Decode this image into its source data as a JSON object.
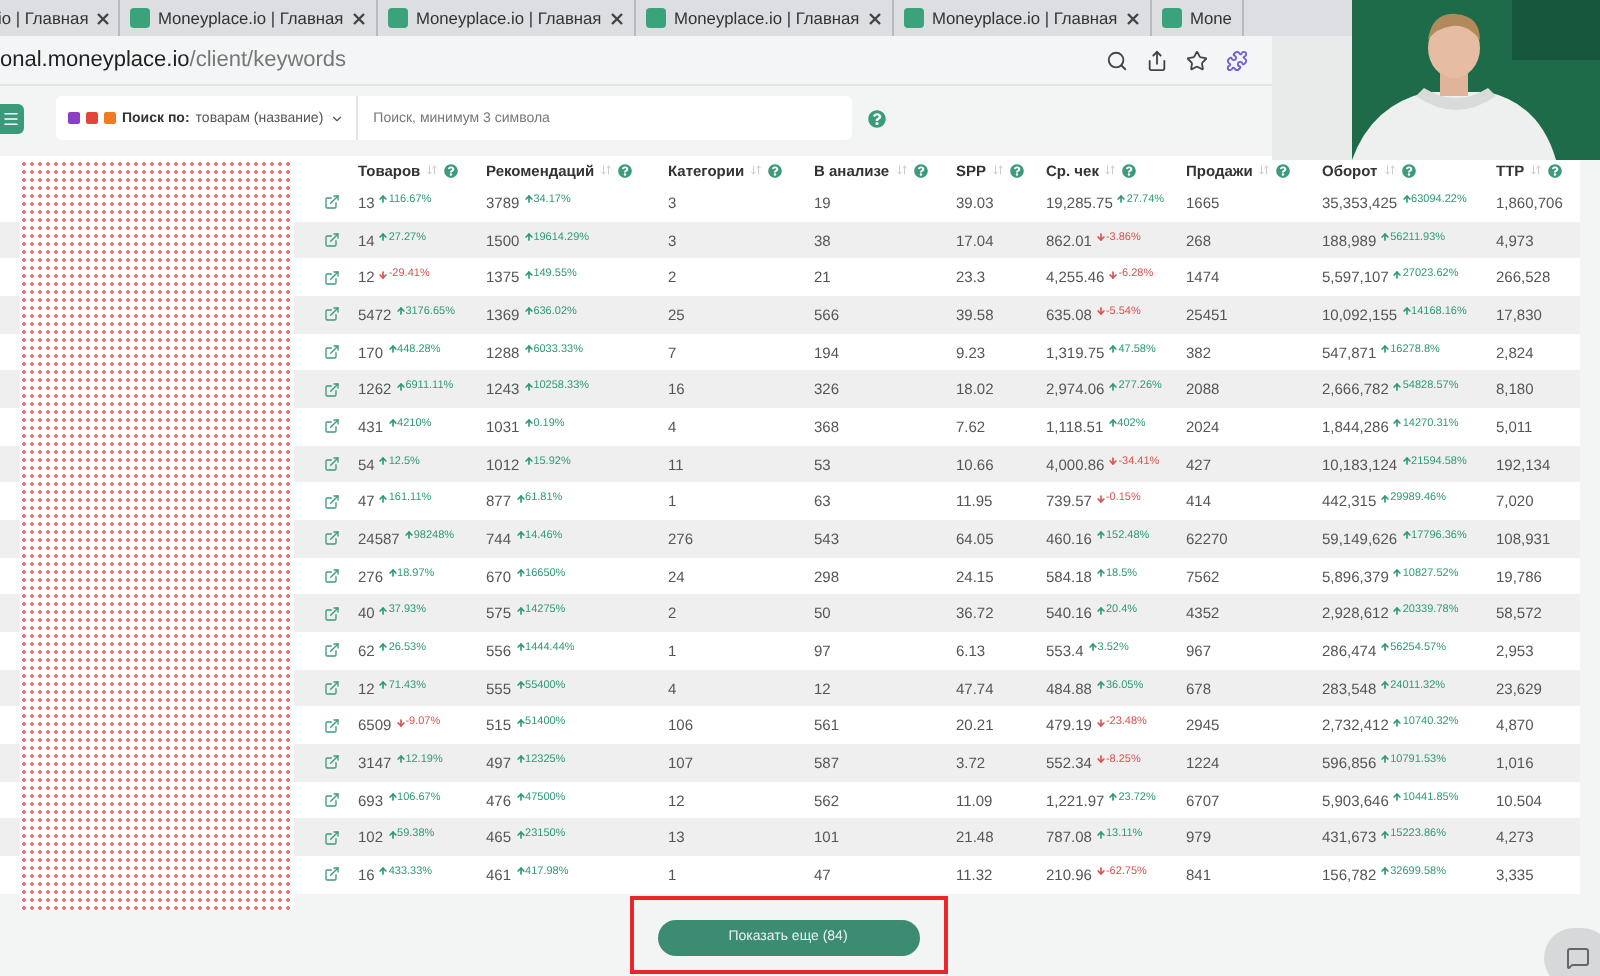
{
  "browser": {
    "tabs": [
      {
        "title": "io | Главная"
      },
      {
        "title": "Moneyplace.io | Главная"
      },
      {
        "title": "Moneyplace.io | Главная"
      },
      {
        "title": "Moneyplace.io | Главная"
      },
      {
        "title": "Moneyplace.io | Главная"
      },
      {
        "title": "Mone"
      }
    ],
    "address": {
      "host": "onal.moneyplace.io",
      "path": "/client/keywords"
    }
  },
  "search": {
    "label": "Поиск по:",
    "scope": "товарам (название)",
    "placeholder": "Поиск, минимум 3 символа"
  },
  "table": {
    "columns": [
      "Товаров",
      "Рекомендаций",
      "Категории",
      "В анализе",
      "SPP",
      "Ср. чек",
      "Продажи",
      "Оборот",
      "TTP"
    ],
    "rows": [
      [
        {
          "value": "13",
          "change": "116.67%",
          "up": true
        },
        {
          "value": "3789",
          "change": "34.17%",
          "up": true
        },
        "3",
        "19",
        "39.03",
        {
          "value": "19,285.75",
          "change": "27.74%",
          "up": true
        },
        "1665",
        {
          "value": "35,353,425",
          "change": "63094.22%",
          "up": true
        },
        "1,860,706"
      ],
      [
        {
          "value": "14",
          "change": "27.27%",
          "up": true
        },
        {
          "value": "1500",
          "change": "19614.29%",
          "up": true
        },
        "3",
        "38",
        "17.04",
        {
          "value": "862.01",
          "change": "-3.86%",
          "up": false
        },
        "268",
        {
          "value": "188,989",
          "change": "56211.93%",
          "up": true
        },
        "4,973"
      ],
      [
        {
          "value": "12",
          "change": "-29.41%",
          "up": false
        },
        {
          "value": "1375",
          "change": "149.55%",
          "up": true
        },
        "2",
        "21",
        "23.3",
        {
          "value": "4,255.46",
          "change": "-6.28%",
          "up": false
        },
        "1474",
        {
          "value": "5,597,107",
          "change": "27023.62%",
          "up": true
        },
        "266,528"
      ],
      [
        {
          "value": "5472",
          "change": "3176.65%",
          "up": true
        },
        {
          "value": "1369",
          "change": "636.02%",
          "up": true
        },
        "25",
        "566",
        "39.58",
        {
          "value": "635.08",
          "change": "-5.54%",
          "up": false
        },
        "25451",
        {
          "value": "10,092,155",
          "change": "14168.16%",
          "up": true
        },
        "17,830"
      ],
      [
        {
          "value": "170",
          "change": "448.28%",
          "up": true
        },
        {
          "value": "1288",
          "change": "6033.33%",
          "up": true
        },
        "7",
        "194",
        "9.23",
        {
          "value": "1,319.75",
          "change": "47.58%",
          "up": true
        },
        "382",
        {
          "value": "547,871",
          "change": "16278.8%",
          "up": true
        },
        "2,824"
      ],
      [
        {
          "value": "1262",
          "change": "6911.11%",
          "up": true
        },
        {
          "value": "1243",
          "change": "10258.33%",
          "up": true
        },
        "16",
        "326",
        "18.02",
        {
          "value": "2,974.06",
          "change": "277.26%",
          "up": true
        },
        "2088",
        {
          "value": "2,666,782",
          "change": "54828.57%",
          "up": true
        },
        "8,180"
      ],
      [
        {
          "value": "431",
          "change": "4210%",
          "up": true
        },
        {
          "value": "1031",
          "change": "0.19%",
          "up": true
        },
        "4",
        "368",
        "7.62",
        {
          "value": "1,118.51",
          "change": "402%",
          "up": true
        },
        "2024",
        {
          "value": "1,844,286",
          "change": "14270.31%",
          "up": true
        },
        "5,011"
      ],
      [
        {
          "value": "54",
          "change": "12.5%",
          "up": true
        },
        {
          "value": "1012",
          "change": "15.92%",
          "up": true
        },
        "11",
        "53",
        "10.66",
        {
          "value": "4,000.86",
          "change": "-34.41%",
          "up": false
        },
        "427",
        {
          "value": "10,183,124",
          "change": "21594.58%",
          "up": true
        },
        "192,134"
      ],
      [
        {
          "value": "47",
          "change": "161.11%",
          "up": true
        },
        {
          "value": "877",
          "change": "61.81%",
          "up": true
        },
        "1",
        "63",
        "11.95",
        {
          "value": "739.57",
          "change": "-0.15%",
          "up": false
        },
        "414",
        {
          "value": "442,315",
          "change": "29989.46%",
          "up": true
        },
        "7,020"
      ],
      [
        {
          "value": "24587",
          "change": "98248%",
          "up": true
        },
        {
          "value": "744",
          "change": "14.46%",
          "up": true
        },
        "276",
        "543",
        "64.05",
        {
          "value": "460.16",
          "change": "152.48%",
          "up": true
        },
        "62270",
        {
          "value": "59,149,626",
          "change": "17796.36%",
          "up": true
        },
        "108,931"
      ],
      [
        {
          "value": "276",
          "change": "18.97%",
          "up": true
        },
        {
          "value": "670",
          "change": "16650%",
          "up": true
        },
        "24",
        "298",
        "24.15",
        {
          "value": "584.18",
          "change": "18.5%",
          "up": true
        },
        "7562",
        {
          "value": "5,896,379",
          "change": "10827.52%",
          "up": true
        },
        "19,786"
      ],
      [
        {
          "value": "40",
          "change": "37.93%",
          "up": true
        },
        {
          "value": "575",
          "change": "14275%",
          "up": true
        },
        "2",
        "50",
        "36.72",
        {
          "value": "540.16",
          "change": "20.4%",
          "up": true
        },
        "4352",
        {
          "value": "2,928,612",
          "change": "20339.78%",
          "up": true
        },
        "58,572"
      ],
      [
        {
          "value": "62",
          "change": "26.53%",
          "up": true
        },
        {
          "value": "556",
          "change": "1444.44%",
          "up": true
        },
        "1",
        "97",
        "6.13",
        {
          "value": "553.4",
          "change": "3.52%",
          "up": true
        },
        "967",
        {
          "value": "286,474",
          "change": "56254.57%",
          "up": true
        },
        "2,953"
      ],
      [
        {
          "value": "12",
          "change": "71.43%",
          "up": true
        },
        {
          "value": "555",
          "change": "55400%",
          "up": true
        },
        "4",
        "12",
        "47.74",
        {
          "value": "484.88",
          "change": "36.05%",
          "up": true
        },
        "678",
        {
          "value": "283,548",
          "change": "24011.32%",
          "up": true
        },
        "23,629"
      ],
      [
        {
          "value": "6509",
          "change": "-9.07%",
          "up": false
        },
        {
          "value": "515",
          "change": "51400%",
          "up": true
        },
        "106",
        "561",
        "20.21",
        {
          "value": "479.19",
          "change": "-23.48%",
          "up": false
        },
        "2945",
        {
          "value": "2,732,412",
          "change": "10740.32%",
          "up": true
        },
        "4,870"
      ],
      [
        {
          "value": "3147",
          "change": "12.19%",
          "up": true
        },
        {
          "value": "497",
          "change": "12325%",
          "up": true
        },
        "107",
        "587",
        "3.72",
        {
          "value": "552.34",
          "change": "-8.25%",
          "up": false
        },
        "1224",
        {
          "value": "596,856",
          "change": "10791.53%",
          "up": true
        },
        "1,016"
      ],
      [
        {
          "value": "693",
          "change": "106.67%",
          "up": true
        },
        {
          "value": "476",
          "change": "47500%",
          "up": true
        },
        "12",
        "562",
        "11.09",
        {
          "value": "1,221.97",
          "change": "23.72%",
          "up": true
        },
        "6707",
        {
          "value": "5,903,646",
          "change": "10441.85%",
          "up": true
        },
        "10.504"
      ],
      [
        {
          "value": "102",
          "change": "59.38%",
          "up": true
        },
        {
          "value": "465",
          "change": "23150%",
          "up": true
        },
        "13",
        "101",
        "21.48",
        {
          "value": "787.08",
          "change": "13.11%",
          "up": true
        },
        "979",
        {
          "value": "431,673",
          "change": "15223.86%",
          "up": true
        },
        "4,273"
      ],
      [
        {
          "value": "16",
          "change": "433.33%",
          "up": true
        },
        {
          "value": "461",
          "change": "417.98%",
          "up": true
        },
        "1",
        "47",
        "11.32",
        {
          "value": "210.96",
          "change": "-62.75%",
          "up": false
        },
        "841",
        {
          "value": "156,782",
          "change": "32699.58%",
          "up": true
        },
        "3,335"
      ]
    ]
  },
  "show_more": {
    "label": "Показать еще (84)",
    "highlighted": true
  }
}
